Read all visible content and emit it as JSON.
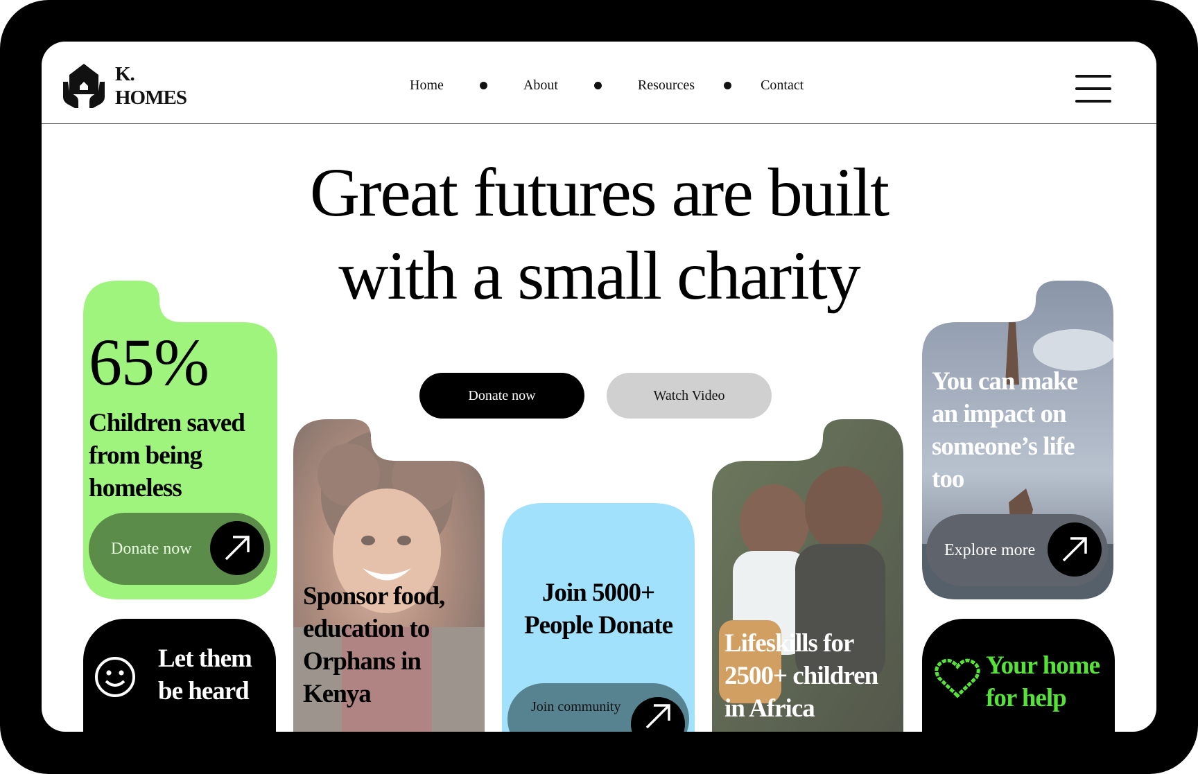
{
  "brand": {
    "line1": "K.",
    "line2": "HOMES"
  },
  "nav": {
    "items": [
      "Home",
      "About",
      "Resources",
      "Contact"
    ]
  },
  "hero": {
    "line1": "Great futures are built",
    "line2": "with a small charity"
  },
  "cta": {
    "primary": "Donate now",
    "secondary": "Watch Video"
  },
  "cards": {
    "stat": {
      "value": "65%",
      "text": "Children saved from being homeless",
      "button": "Donate now"
    },
    "sponsor": {
      "text": "Sponsor food, education to Orphans in Kenya"
    },
    "join": {
      "text": "Join 5000+ People Donate",
      "button": "Join community"
    },
    "lifeskills": {
      "text": "Lifeskills for 2500+ children in Africa"
    },
    "impact": {
      "text": "You can make an impact on someone’s life too",
      "button": "Explore more"
    },
    "heard": {
      "text": "Let them be heard"
    },
    "home": {
      "text": "Your home for help"
    }
  },
  "colors": {
    "green": "#9ef47c",
    "blue": "#a1e1fb",
    "black": "#000000",
    "neon": "#57e23a"
  },
  "icons": [
    "logo-icon",
    "hamburger-icon",
    "arrow-up-right-icon",
    "smiley-icon",
    "heart-icon"
  ]
}
